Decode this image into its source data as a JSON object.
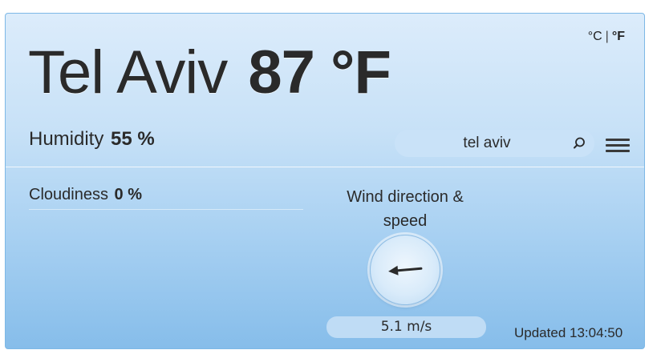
{
  "units": {
    "celsius_label": "°C",
    "separator": "|",
    "fahrenheit_label": "°F",
    "active": "fahrenheit"
  },
  "location": {
    "city": "Tel Aviv",
    "temperature": "87 °F"
  },
  "humidity": {
    "label": "Humidity",
    "value": "55 %"
  },
  "search": {
    "value": "tel aviv",
    "icon": "search-icon"
  },
  "menu": {
    "icon": "hamburger-menu-icon"
  },
  "cloudiness": {
    "label": "Cloudiness",
    "value": "0 %"
  },
  "wind": {
    "label": "Wind direction & speed",
    "direction_icon": "wind-arrow-icon",
    "direction_deg": 265,
    "speed": "5.1 m/s"
  },
  "status": {
    "updated": "Updated 13:04:50"
  },
  "colors": {
    "background_top": "#dcecfb",
    "background_bottom": "#86bdea",
    "text": "#2a2a2a"
  }
}
